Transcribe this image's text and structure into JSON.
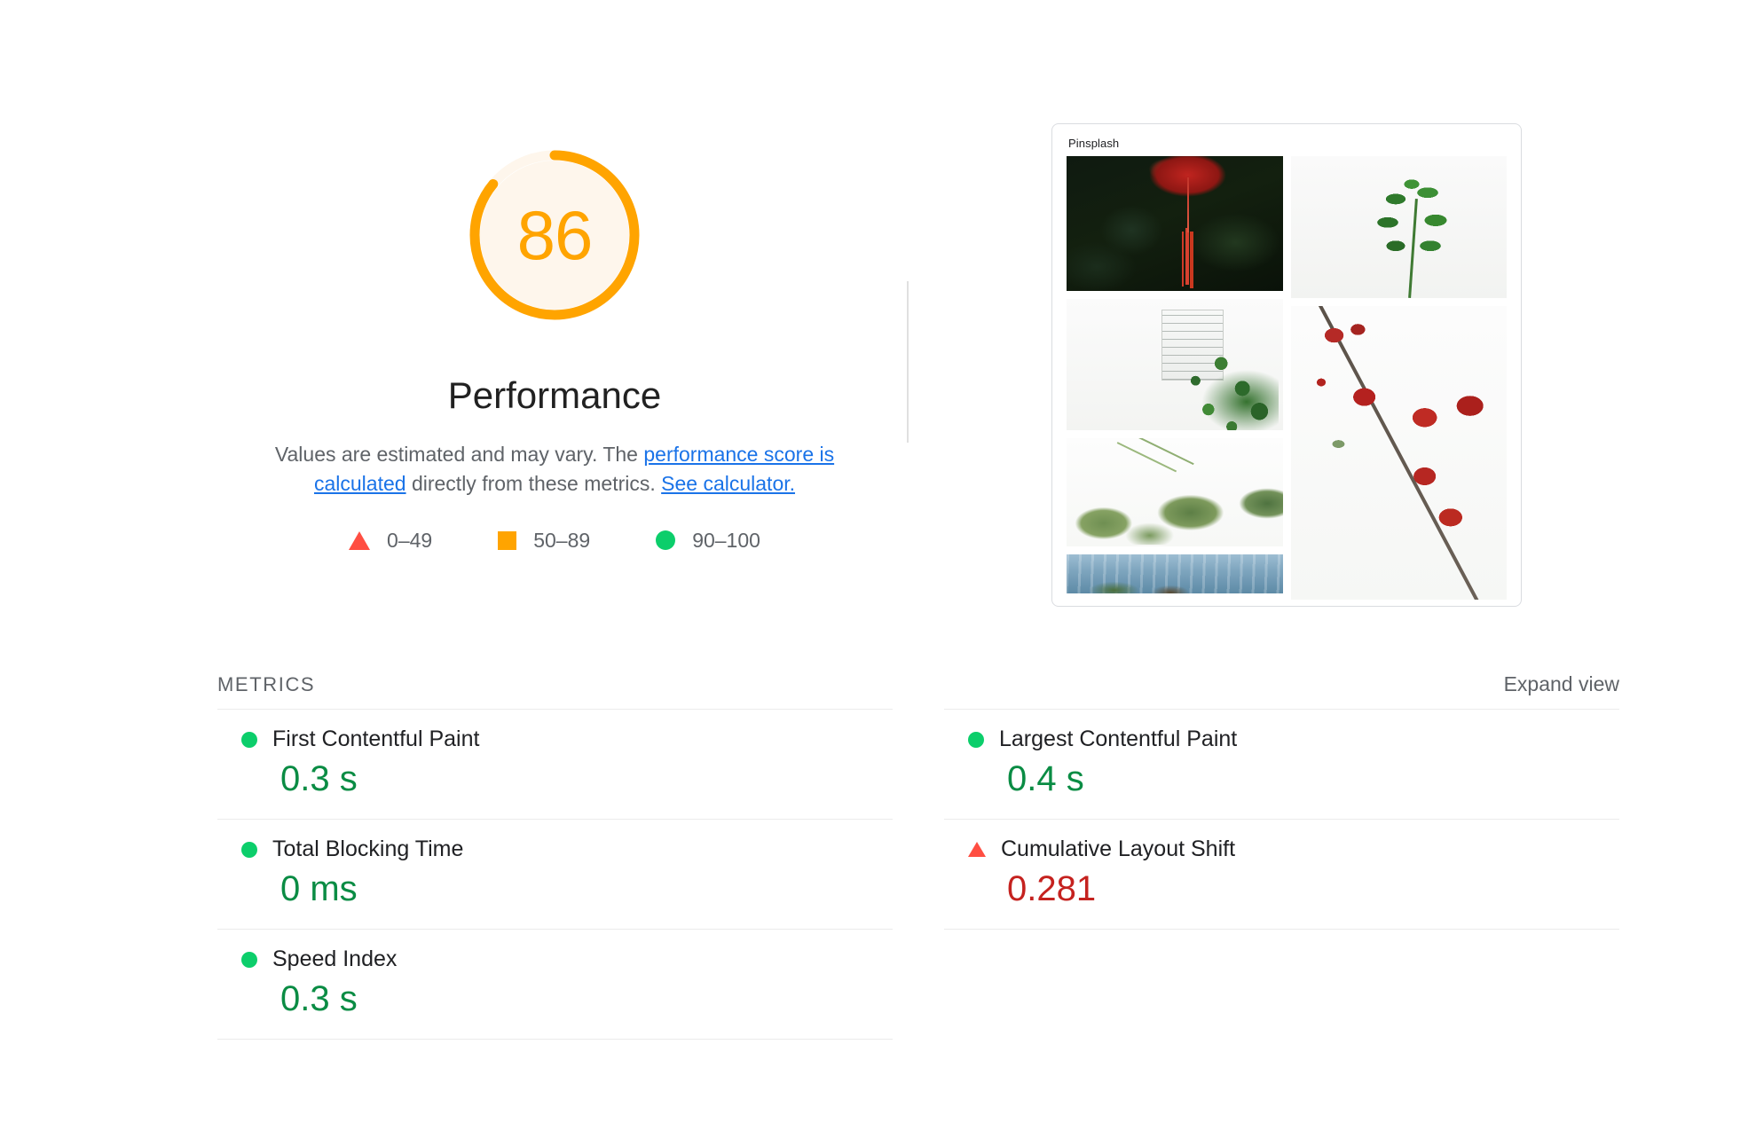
{
  "gauge": {
    "score": "86",
    "title": "Performance",
    "score_color": "#ffa400",
    "track_color": "#fef6ec",
    "percent": 86,
    "description": {
      "lead": "Values are estimated and may vary. The ",
      "link1": "performance score is calculated",
      "middle": " directly from these metrics. ",
      "link2": "See calculator.",
      "link_color": "#1a73e8"
    }
  },
  "legend": {
    "items": [
      {
        "icon": "triangle-fail-icon",
        "label": "0–49",
        "color": "#ff4e42"
      },
      {
        "icon": "square-average-icon",
        "label": "50–89",
        "color": "#ffa400"
      },
      {
        "icon": "circle-pass-icon",
        "label": "90–100",
        "color": "#0cce6b"
      }
    ]
  },
  "thumbnail": {
    "brand": "Pinsplash",
    "tiles_left": [
      "hibiscus-photo",
      "ivy-wall-photo",
      "ginkgo-leaves-photo",
      "mountain-photo"
    ],
    "tiles_right": [
      "green-sprig-photo",
      "red-blossom-branch-photo"
    ]
  },
  "metrics": {
    "section_title": "METRICS",
    "expand_label": "Expand view",
    "left_column": [
      {
        "name": "First Contentful Paint",
        "value": "0.3 s",
        "rating": "pass",
        "icon": "circle-pass-icon",
        "value_color": "#0a8c44"
      },
      {
        "name": "Total Blocking Time",
        "value": "0 ms",
        "rating": "pass",
        "icon": "circle-pass-icon",
        "value_color": "#0a8c44"
      },
      {
        "name": "Speed Index",
        "value": "0.3 s",
        "rating": "pass",
        "icon": "circle-pass-icon",
        "value_color": "#0a8c44"
      }
    ],
    "right_column": [
      {
        "name": "Largest Contentful Paint",
        "value": "0.4 s",
        "rating": "pass",
        "icon": "circle-pass-icon",
        "value_color": "#0a8c44"
      },
      {
        "name": "Cumulative Layout Shift",
        "value": "0.281",
        "rating": "fail",
        "icon": "triangle-fail-icon",
        "value_color": "#c5221f"
      }
    ]
  }
}
